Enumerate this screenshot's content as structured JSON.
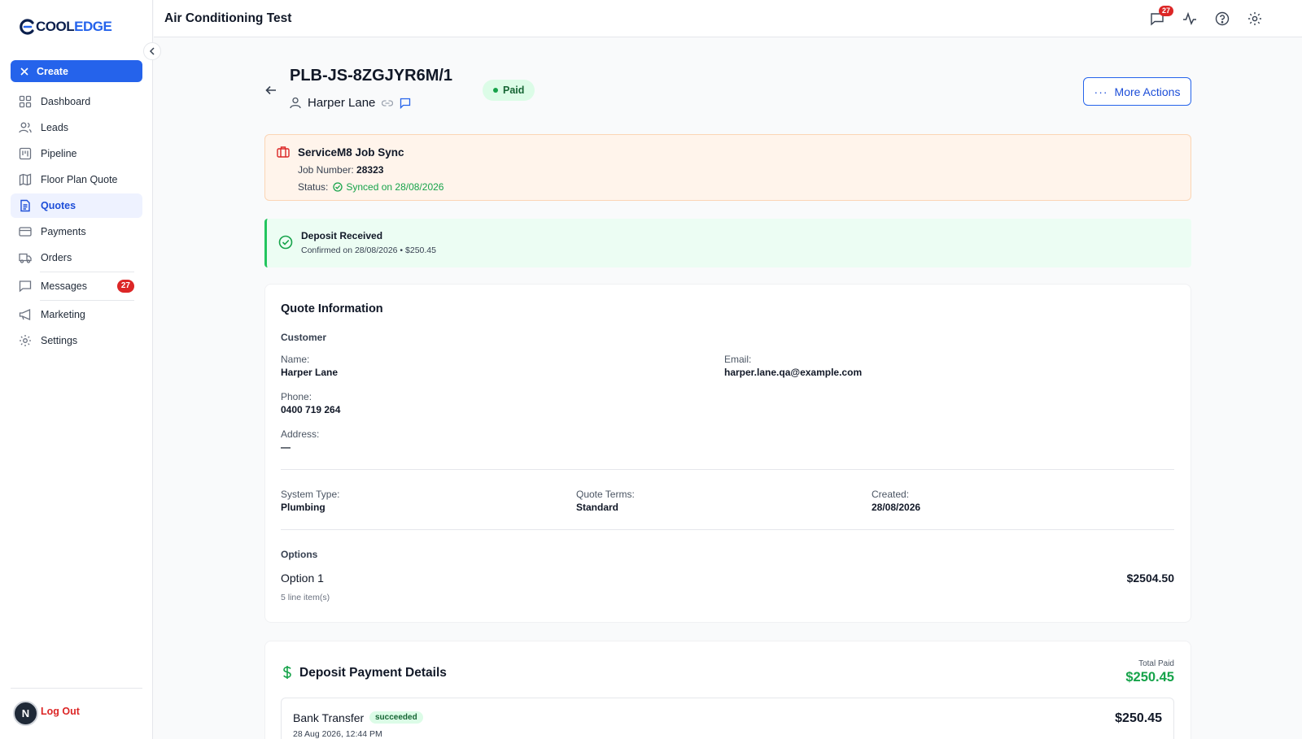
{
  "brand": {
    "logo_prefix": "COOL",
    "logo_suffix": "EDGE",
    "accent": "#2563eb"
  },
  "sidebar": {
    "create_label": "Create",
    "items": [
      {
        "label": "Dashboard",
        "icon": "dashboard-icon"
      },
      {
        "label": "Leads",
        "icon": "users-icon"
      },
      {
        "label": "Pipeline",
        "icon": "pipeline-icon"
      },
      {
        "label": "Floor Plan Quote",
        "icon": "map-icon"
      },
      {
        "label": "Quotes",
        "icon": "document-icon",
        "active": true
      },
      {
        "label": "Payments",
        "icon": "credit-card-icon"
      },
      {
        "label": "Orders",
        "icon": "truck-icon"
      },
      {
        "label": "Messages",
        "icon": "message-icon",
        "badge": "27"
      },
      {
        "label": "Marketing",
        "icon": "megaphone-icon"
      },
      {
        "label": "Settings",
        "icon": "gear-icon"
      }
    ],
    "avatar_initial": "N",
    "logout_label": "Log Out"
  },
  "topbar": {
    "title": "Air Conditioning Test",
    "messages_badge": "27"
  },
  "quote": {
    "id": "PLB-JS-8ZGJYR6M/1",
    "customer_name": "Harper Lane",
    "status": "Paid",
    "more_actions_label": "More Actions"
  },
  "sync": {
    "title": "ServiceM8 Job Sync",
    "job_label": "Job Number:",
    "job_number": "28323",
    "status_label": "Status:",
    "status_value": "Synced on 28/08/2026"
  },
  "deposit_notice": {
    "title": "Deposit Received",
    "subtitle": "Confirmed on 28/08/2026 • $250.45"
  },
  "quote_info": {
    "title": "Quote Information",
    "customer_section": "Customer",
    "name_label": "Name:",
    "name_value": "Harper Lane",
    "email_label": "Email:",
    "email_value": "harper.lane.qa@example.com",
    "phone_label": "Phone:",
    "phone_value": "0400 719 264",
    "address_label": "Address:",
    "address_value": "—",
    "system_type_label": "System Type:",
    "system_type_value": "Plumbing",
    "quote_terms_label": "Quote Terms:",
    "quote_terms_value": "Standard",
    "created_label": "Created:",
    "created_value": "28/08/2026",
    "options_section": "Options",
    "option_name": "Option 1",
    "option_count": "5 line item(s)",
    "option_price": "$2504.50"
  },
  "deposit_details": {
    "title": "Deposit Payment Details",
    "total_paid_label": "Total Paid",
    "total_paid_value": "$250.45",
    "payment_method": "Bank Transfer",
    "payment_status": "succeeded",
    "payment_date": "28 Aug 2026, 12:44 PM",
    "payment_amount": "$250.45"
  }
}
